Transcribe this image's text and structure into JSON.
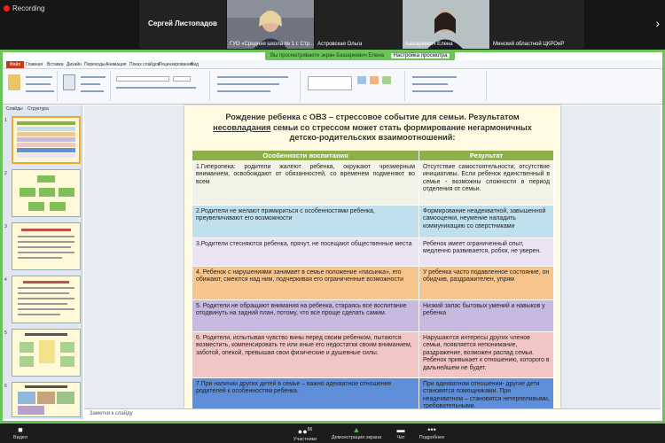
{
  "zoom": {
    "recording_label": "Recording",
    "participants": [
      {
        "name": "Сергей Листопадов"
      },
      {
        "name": "ГУО «Средняя школа № 1 г. Стр..."
      },
      {
        "name": "Астровская Ольга"
      },
      {
        "name": "Башаркевич Елена"
      },
      {
        "name": "Минский областной ЦКРОиР"
      }
    ],
    "next_arrow": "›",
    "banner": "Вы просматриваете экран Башаркевич Елена",
    "banner_menu": "Настройка просмотра",
    "toolbar": {
      "video_label": "Видео",
      "participants_label": "Участники",
      "participants_count": "56",
      "share_label": "Демонстрация экрана",
      "chat_label": "Чат",
      "more_label": "Подробнее"
    }
  },
  "ppt": {
    "file_tab": "Файл",
    "tabs": [
      "Главная",
      "Вставка",
      "Дизайн",
      "Переходы",
      "Анимация",
      "Показ слайдов",
      "Рецензирование",
      "Вид"
    ],
    "panel_tabs": [
      "Слайды",
      "Структура"
    ],
    "thumb_numbers": [
      "1",
      "2",
      "3",
      "4",
      "5",
      "6"
    ],
    "notes_placeholder": "Заметки к слайду"
  },
  "slide": {
    "title_line1": "Рождение ребенка с ОВЗ –  стрессовое событие для семьи.  Результатом",
    "title_underlined": "несовладания",
    "title_line2_rest": " семьи со стрессом может стать формирование негармоничных",
    "title_line3": "детско-родительских взаимоотношений:",
    "col_headers": [
      "Особенности воспитания",
      "Результат"
    ],
    "rows": [
      {
        "left": "1.Гиперопека: родители жалеют ребенка, окружают чрезмерным вниманием, освобождают от обязанностей, со временем подменяют во всем",
        "right": "Отсутствие самостоятельности, отсутствие инициативы. Если ребенок единственный в семье - возможны сложности в период отделения от семьи."
      },
      {
        "left": "2.Родители не желают примириться с особенностями ребенка, преувеличивают его возможности",
        "right": "Формирование неадекватной, завышенной самооценки, неумение наладить коммуникацию со сверстниками"
      },
      {
        "left": "3.Родители стесняются ребенка, прячут, не посещают общественные места",
        "right": "Ребенок имеет ограниченный опыт, медленно развивается, робок, не уверен."
      },
      {
        "left": "4. Ребенок с нарушениями занимает в семье положение «пасынка», его обижают, смеются над ним, подчеркивая его ограниченные возможности",
        "right": "У ребенка часто подавленное состояние, он обидчив, раздражителен, упрям"
      },
      {
        "left": "5. Родители не обращают внимания на ребенка, стараясь все воспитание отодвинуть на задний план, потому, что все проще сделать самим.",
        "right": "Низкий запас бытовых умений и навыков у ребенка"
      },
      {
        "left": "6. Родители, испытывая чувство вины перед своим ребенком, пытаются возместить, компенсировать те или иные его недостатки своим вниманием, заботой, опекой, превышая свои физические и душевные силы.",
        "right": "Нарушаются интересы других членов семьи, появляется непонимание, раздражение, возможен распад семьи. Ребенок привыкает к отношению, которого в дальнейшем не будет."
      },
      {
        "left": "7.При наличии других детей в семье – важно адекватное отношение родителей к  особенностям ребенка.",
        "right": "При адекватном отношении- другие дети становятся помощниками. При неадекватном –  становятся нетерпеливыми, требовательными."
      }
    ]
  }
}
